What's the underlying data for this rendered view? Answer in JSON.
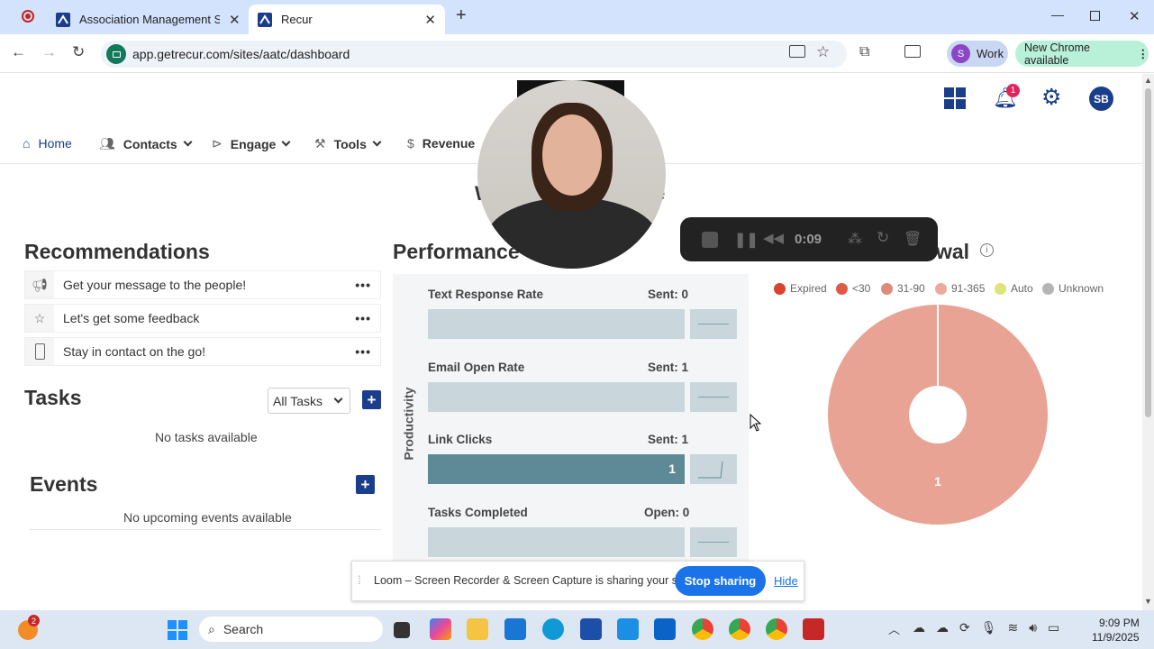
{
  "browser": {
    "tabs": [
      {
        "title": "Association Management Softw",
        "active": false
      },
      {
        "title": "Recur",
        "active": true
      }
    ],
    "url": "app.getrecur.com/sites/aatc/dashboard",
    "profile_initial": "S",
    "profile_label": "Work",
    "update_label": "New Chrome available"
  },
  "app": {
    "notification_count": "1",
    "user_initials": "SB",
    "nav": [
      {
        "label": "Home",
        "icon": "home-icon"
      },
      {
        "label": "Contacts",
        "icon": "contacts-icon"
      },
      {
        "label": "Engage",
        "icon": "engage-icon"
      },
      {
        "label": "Tools",
        "icon": "tools-icon"
      },
      {
        "label": "Revenue",
        "icon": "revenue-icon"
      }
    ],
    "welcome_partial_left": "W",
    "welcome_partial_right": "e"
  },
  "recommendations": {
    "title": "Recommendations",
    "items": [
      {
        "label": "Get your message to the people!",
        "icon": "megaphone-icon"
      },
      {
        "label": "Let's get some feedback",
        "icon": "star-icon"
      },
      {
        "label": "Stay in contact on the go!",
        "icon": "phone-icon"
      }
    ]
  },
  "tasks": {
    "title": "Tasks",
    "filter": "All Tasks",
    "empty": "No tasks available"
  },
  "events": {
    "title": "Events",
    "empty": "No upcoming events available"
  },
  "performance": {
    "title": "Performance",
    "side_label": "Productivity",
    "rows": [
      {
        "label": "Text Response Rate",
        "stat": "Sent: 0",
        "value": "",
        "fill": 0
      },
      {
        "label": "Email Open Rate",
        "stat": "Sent: 1",
        "value": "",
        "fill": 0
      },
      {
        "label": "Link Clicks",
        "stat": "Sent: 1",
        "value": "1",
        "fill": 1
      },
      {
        "label": "Tasks Completed",
        "stat": "Open: 0",
        "value": "",
        "fill": 0
      }
    ]
  },
  "renewal": {
    "title_partial": "wal",
    "legend": [
      {
        "label": "Expired",
        "color": "#d9432f"
      },
      {
        "label": "<30",
        "color": "#df5a46"
      },
      {
        "label": "31-90",
        "color": "#e08a7a"
      },
      {
        "label": "91-365",
        "color": "#eca99c"
      },
      {
        "label": "Auto",
        "color": "#dde57a"
      },
      {
        "label": "Unknown",
        "color": "#b5b5b5"
      }
    ],
    "donut_value": "1",
    "donut_color": "#e8a395"
  },
  "recorder": {
    "time": "0:09"
  },
  "loom": {
    "message": "Loom – Screen Recorder & Screen Capture is sharing your screen.",
    "stop_label": "Stop sharing",
    "hide_label": "Hide"
  },
  "taskbar": {
    "search_label": "Search",
    "time": "9:09 PM",
    "date": "11/9/2025",
    "badge_count": "2"
  }
}
